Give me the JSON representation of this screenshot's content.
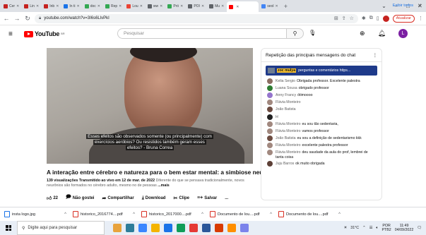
{
  "browser": {
    "tabs": [
      {
        "label": "Cer",
        "color": "#c5221f"
      },
      {
        "label": "Lin",
        "color": "#c5221f"
      },
      {
        "label": "Inb",
        "color": "#c5221f"
      },
      {
        "label": "In ti",
        "color": "#1a73e8"
      },
      {
        "label": "doc",
        "color": "#34a853"
      },
      {
        "label": "Rep",
        "color": "#34a853"
      },
      {
        "label": "Lou",
        "color": "#ea4335"
      },
      {
        "label": "ww",
        "color": "#5f6368"
      },
      {
        "label": "Pró",
        "color": "#34a853"
      },
      {
        "label": "POI",
        "color": "#5f6368"
      },
      {
        "label": "Mu",
        "color": "#5f6368"
      },
      {
        "label": "",
        "color": "#ff0000",
        "active": true
      },
      {
        "label": "seol",
        "color": "#4285f4"
      }
    ],
    "url": "youtube.com/watch?v=3I6s6LlvPkI",
    "update_label": "Atualizar"
  },
  "youtube": {
    "logo_text": "YouTube",
    "logo_country": "BR",
    "search_placeholder": "Pesquisar",
    "user_initial": "L"
  },
  "video": {
    "caption_lines": [
      "Esses efeitos são observados somente (ou principalmente) com",
      "exercícios aeróbios? Ou resistidos também geram esses",
      "efeitos? - Bruna Correa"
    ],
    "title": "A interação entre cérebro e natureza para o bem estar mental: a simbiose neural.",
    "meta": "139 visualizações  Transmitido ao vivo em 12 de mar. de 2022",
    "desc": " Diferente do que se pensava tradicionalmente, novos neurônios são formados no cérebro adulto, mesmo no de pessoas",
    "more": "...mais",
    "likes": "22",
    "dislike_label": "Não gostei",
    "share_label": "Compartilhar",
    "download_label": "Download",
    "clip_label": "Clipe",
    "save_label": "Salvar",
    "more_label": "..."
  },
  "chat": {
    "header": "Repetição das principais mensagens do chat",
    "pinned": {
      "author": "zoc mulya",
      "text": "perguntas e comentários https..."
    },
    "messages": [
      {
        "author": "Kelia Sergio",
        "text": "Obrigada professor. Excelente palestra",
        "color": "#8d6e63"
      },
      {
        "author": "Luana Sousa",
        "text": "obrigado professor",
        "color": "#2e7d32"
      },
      {
        "author": "Anny Francy",
        "text": "ótimoooo",
        "color": "#9575cd"
      },
      {
        "author": "Flávia Monteiro",
        "text": "",
        "color": "#a1887f"
      },
      {
        "author": "João Batista",
        "text": "",
        "color": "#6d4c41"
      },
      {
        "author": "H",
        "text": "",
        "color": "#212121"
      },
      {
        "author": "Flávia Monteiro",
        "text": "eu sou tão sedentaria,",
        "color": "#a1887f"
      },
      {
        "author": "Flávia Monteiro",
        "text": "vamos professor",
        "color": "#a1887f"
      },
      {
        "author": "João Batista",
        "text": "eu sou a definição de sedentarismo kkk",
        "color": "#6d4c41"
      },
      {
        "author": "Flávia Monteiro",
        "text": "excelente palestra professor",
        "color": "#a1887f"
      },
      {
        "author": "Flávia Monteiro",
        "text": "deu saudade da aula do prof, lembrei de tanta coisa",
        "color": "#a1887f"
      },
      {
        "author": "Juju Barros",
        "text": "ok muito obrigada",
        "color": "#5d4037"
      }
    ]
  },
  "downloads": {
    "items": [
      {
        "name": "insta logo.jpg",
        "color": "#1a73e8"
      },
      {
        "name": "historico_2016774....pdf",
        "color": "#d93025"
      },
      {
        "name": "historico_2017000....pdf",
        "color": "#d93025"
      },
      {
        "name": "Documento de lou....pdf",
        "color": "#d93025"
      },
      {
        "name": "Documento de lou....pdf",
        "color": "#d93025"
      }
    ],
    "show_all": "Exibir todos"
  },
  "taskbar": {
    "search_placeholder": "Digite aqui para pesquisar",
    "weather": "31°C",
    "lang": "POR",
    "lang2": "PTB2",
    "time": "11:49",
    "date": "04/09/2022",
    "app_colors": [
      "#e8a33d",
      "#2d7d9a",
      "#3a86ff",
      "#f4b400",
      "#1a73e8",
      "#0f9d58",
      "#e53935",
      "#2b579a",
      "#d83b01",
      "#ff8f00",
      "#7b83eb"
    ]
  }
}
